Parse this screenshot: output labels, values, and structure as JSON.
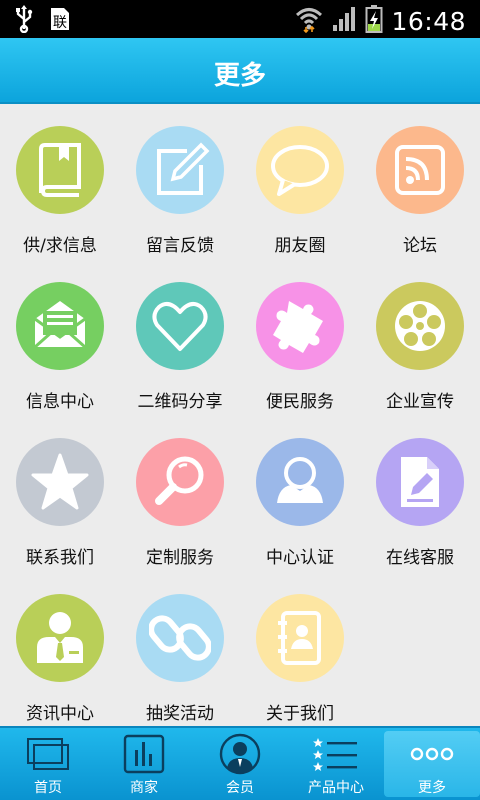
{
  "status_bar": {
    "time": "16:48",
    "icons": [
      "usb-icon",
      "sim-icon",
      "wifi-icon",
      "signal-icon",
      "battery-charging-icon"
    ]
  },
  "header": {
    "title": "更多"
  },
  "menu": {
    "items": [
      {
        "label": "供/求信息",
        "icon": "book-icon",
        "color": "#b9cf58"
      },
      {
        "label": "留言反馈",
        "icon": "edit-icon",
        "color": "#a9dbf3"
      },
      {
        "label": "朋友圈",
        "icon": "chat-bubble-icon",
        "color": "#fde6a2"
      },
      {
        "label": "论坛",
        "icon": "rss-icon",
        "color": "#fcb88c"
      },
      {
        "label": "信息中心",
        "icon": "mail-icon",
        "color": "#76cf61"
      },
      {
        "label": "二维码分享",
        "icon": "heart-icon",
        "color": "#5fc8b9"
      },
      {
        "label": "便民服务",
        "icon": "puzzle-icon",
        "color": "#f792e7"
      },
      {
        "label": "企业宣传",
        "icon": "film-reel-icon",
        "color": "#cbc95e"
      },
      {
        "label": "联系我们",
        "icon": "star-icon",
        "color": "#c3c9d2"
      },
      {
        "label": "定制服务",
        "icon": "magnifier-icon",
        "color": "#fca0a8"
      },
      {
        "label": "中心认证",
        "icon": "user-icon",
        "color": "#9bb8e9"
      },
      {
        "label": "在线客服",
        "icon": "document-edit-icon",
        "color": "#b5a5f3"
      },
      {
        "label": "资讯中心",
        "icon": "businessman-icon",
        "color": "#b9cf58"
      },
      {
        "label": "抽奖活动",
        "icon": "chain-link-icon",
        "color": "#a9dbf3"
      },
      {
        "label": "关于我们",
        "icon": "contacts-book-icon",
        "color": "#fde6a2"
      }
    ]
  },
  "bottom_nav": {
    "items": [
      {
        "label": "首页",
        "icon": "home-windows-icon"
      },
      {
        "label": "商家",
        "icon": "merchant-chart-icon"
      },
      {
        "label": "会员",
        "icon": "member-icon"
      },
      {
        "label": "产品中心",
        "icon": "star-list-icon"
      },
      {
        "label": "更多",
        "icon": "more-dots-icon",
        "active": true
      }
    ]
  }
}
